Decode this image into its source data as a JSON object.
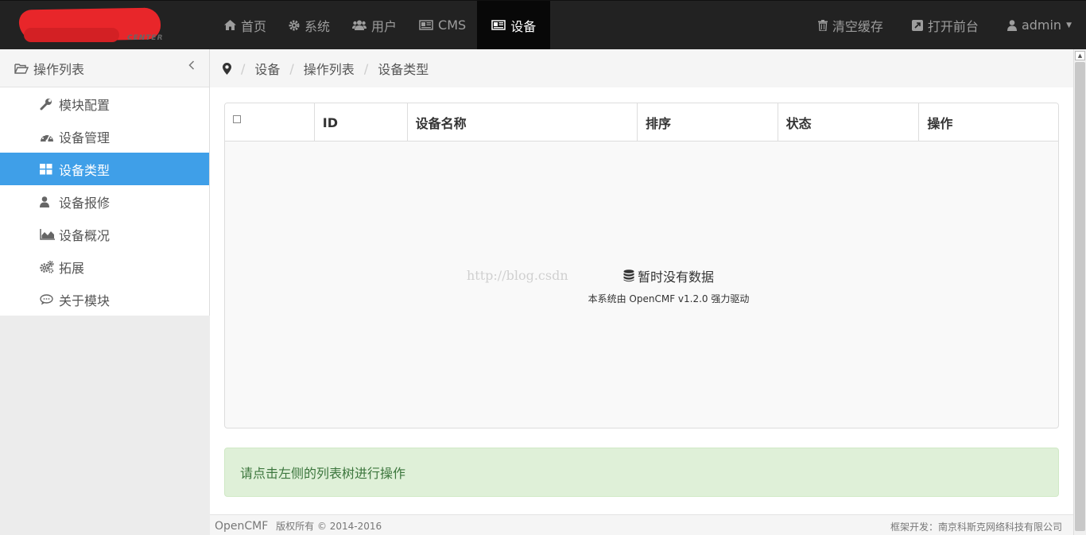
{
  "topbar": {
    "logo_sub": "CENTER",
    "nav": [
      {
        "label": "首页",
        "icon": "home-icon"
      },
      {
        "label": "系统",
        "icon": "gear-icon"
      },
      {
        "label": "用户",
        "icon": "users-icon"
      },
      {
        "label": "CMS",
        "icon": "newspaper-icon"
      },
      {
        "label": "设备",
        "icon": "newspaper-icon",
        "active": true
      }
    ],
    "right": [
      {
        "label": "清空缓存",
        "icon": "trash-icon"
      },
      {
        "label": "打开前台",
        "icon": "external-link-icon"
      },
      {
        "label": "admin",
        "icon": "user-icon"
      }
    ]
  },
  "sidebar": {
    "title": "操作列表",
    "items": [
      {
        "label": "模块配置",
        "icon": "wrench-icon"
      },
      {
        "label": "设备管理",
        "icon": "dashboard-icon"
      },
      {
        "label": "设备类型",
        "icon": "grid-icon",
        "active": true
      },
      {
        "label": "设备报修",
        "icon": "user-icon"
      },
      {
        "label": "设备概况",
        "icon": "area-chart-icon"
      },
      {
        "label": "拓展",
        "icon": "gears-icon"
      },
      {
        "label": "关于模块",
        "icon": "comment-icon"
      }
    ]
  },
  "breadcrumb": [
    "设备",
    "操作列表",
    "设备类型"
  ],
  "table": {
    "columns": [
      "ID",
      "设备名称",
      "排序",
      "状态",
      "操作"
    ],
    "empty_message": "暂时没有数据",
    "powered_by": "本系统由 OpenCMF v1.2.0 强力驱动",
    "watermark": "http://blog.csdn"
  },
  "alert": "请点击左侧的列表树进行操作",
  "footer": {
    "brand": "OpenCMF",
    "copyright": "版权所有 © 2014-2016",
    "developer": "框架开发：南京科斯克网络科技有限公司"
  },
  "colors": {
    "accent": "#3f9fe8",
    "topbar": "#222222",
    "alert_bg": "#dff0d8"
  }
}
